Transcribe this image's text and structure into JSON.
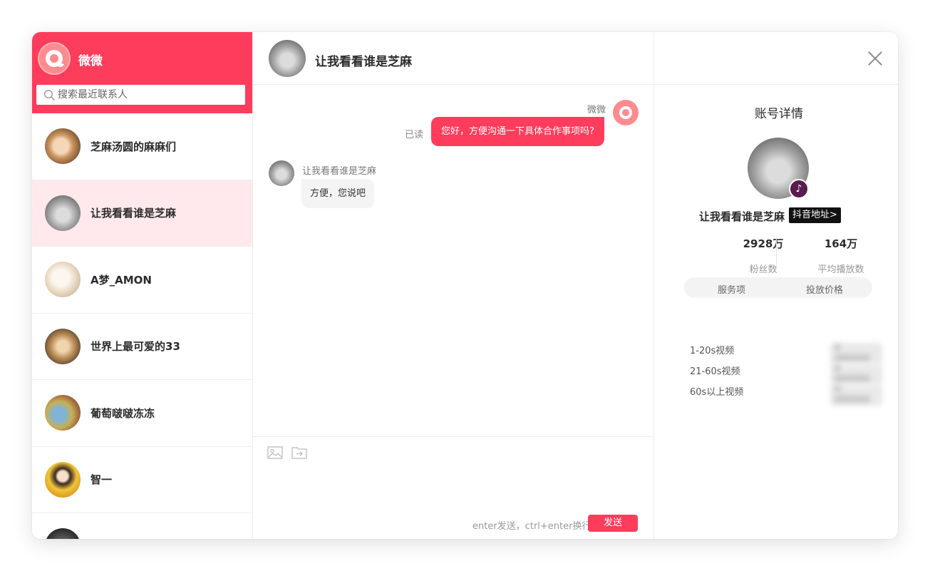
{
  "app": {
    "name": "微微"
  },
  "search": {
    "placeholder": "搜索最近联系人"
  },
  "contacts": [
    {
      "name": "芝麻汤圆的麻麻们"
    },
    {
      "name": "让我看看谁是芝麻"
    },
    {
      "name": "A梦_AMON"
    },
    {
      "name": "世界上最可爱的33"
    },
    {
      "name": "葡萄啵啵冻冻"
    },
    {
      "name": "智一"
    },
    {
      "name": ""
    }
  ],
  "chat": {
    "title": "让我看看谁是芝麻",
    "self_name": "微微",
    "read_status": "已读",
    "self_message": "您好，方便沟通一下具体合作事项吗?",
    "other_name": "让我看看谁是芝麻",
    "other_message": "方便，您说吧",
    "hint": "enter发送，ctrl+enter换行",
    "send_label": "发送"
  },
  "detail": {
    "title": "账号详情",
    "name": "让我看看谁是芝麻",
    "link_label": "抖音地址>",
    "badge": "♪",
    "followers_value": "2928万",
    "followers_label": "粉丝数",
    "plays_value": "164万",
    "plays_label": "平均播放数",
    "service_header": "服务项",
    "price_header": "投放价格",
    "services": [
      {
        "name": "1-20s视频",
        "price": "¥ 000000"
      },
      {
        "name": "21-60s视频",
        "price": "¥ 000000"
      },
      {
        "name": "60s以上视频",
        "price": "¥ 000000"
      }
    ]
  },
  "colors": {
    "accent": "#fe3c5c",
    "active_row": "#ffe9ec",
    "link_bg": "#111111",
    "badge_bg": "#5a1b4f"
  }
}
